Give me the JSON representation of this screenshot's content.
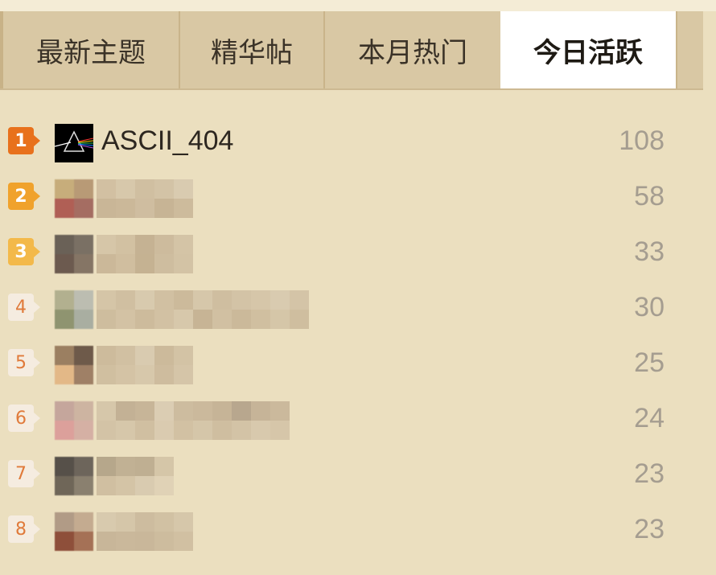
{
  "tabs": [
    {
      "label": "最新主题",
      "active": false
    },
    {
      "label": "精华帖",
      "active": false
    },
    {
      "label": "本月热门",
      "active": false
    },
    {
      "label": "今日活跃",
      "active": true
    }
  ],
  "ranking": [
    {
      "rank": "1",
      "username": "ASCII_404",
      "count": "108",
      "avatar_icon": "prism-avatar-icon"
    },
    {
      "rank": "2",
      "username": "",
      "count": "58",
      "avatar_icon": "blurred-avatar-icon"
    },
    {
      "rank": "3",
      "username": "",
      "count": "33",
      "avatar_icon": "blurred-avatar-icon"
    },
    {
      "rank": "4",
      "username": "",
      "count": "30",
      "avatar_icon": "blurred-avatar-icon"
    },
    {
      "rank": "5",
      "username": "",
      "count": "25",
      "avatar_icon": "blurred-avatar-icon"
    },
    {
      "rank": "6",
      "username": "",
      "count": "24",
      "avatar_icon": "blurred-avatar-icon"
    },
    {
      "rank": "7",
      "username": "",
      "count": "23",
      "avatar_icon": "blurred-avatar-icon"
    },
    {
      "rank": "8",
      "username": "",
      "count": "23",
      "avatar_icon": "blurred-avatar-icon"
    }
  ],
  "colors": {
    "rank1": "#e8711c",
    "rank2": "#f0a22c",
    "rank3": "#f3b94a",
    "rank_other_text": "#e07a3a",
    "count_text": "#a59d90",
    "active_tab_bg": "#ffffff",
    "tab_bg": "#d9c8a4",
    "panel_bg": "#ebdfbf"
  }
}
